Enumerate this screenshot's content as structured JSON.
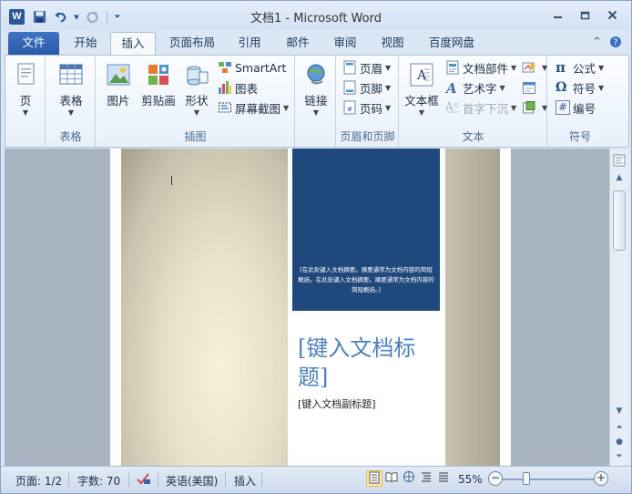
{
  "app": {
    "icon_letter": "W",
    "title": "文档1 - Microsoft Word"
  },
  "tabs": [
    {
      "label": "文件"
    },
    {
      "label": "开始"
    },
    {
      "label": "插入"
    },
    {
      "label": "页面布局"
    },
    {
      "label": "引用"
    },
    {
      "label": "邮件"
    },
    {
      "label": "审阅"
    },
    {
      "label": "视图"
    },
    {
      "label": "百度网盘"
    }
  ],
  "ribbon": {
    "groups": {
      "pages": {
        "label": "",
        "button": "页"
      },
      "table": {
        "label": "表格",
        "button": "表格"
      },
      "illustrations": {
        "label": "插图",
        "picture": "图片",
        "clipart": "剪贴画",
        "shapes": "形状",
        "smartart": "SmartArt",
        "chart": "图表",
        "screenshot": "屏幕截图"
      },
      "links": {
        "label": "",
        "button": "链接"
      },
      "header_footer": {
        "label": "页眉和页脚",
        "header": "页眉",
        "footer": "页脚",
        "page_number": "页码"
      },
      "text": {
        "label": "文本",
        "textbox": "文本框",
        "quick_parts": "文档部件",
        "wordart": "艺术字",
        "drop_cap": "首字下沉"
      },
      "symbols": {
        "label": "符号",
        "equation": "公式",
        "symbol": "符号",
        "number": "编号"
      }
    }
  },
  "document": {
    "abstract": "[在此处键入文档摘要。摘要通常为文档内容的简短概括。在此处键入文档摘要。摘要通常为文档内容的简短概括。]",
    "title": "[键入文档标题]",
    "subtitle": "[键入文档副标题]"
  },
  "status": {
    "page": "页面: 1/2",
    "words": "字数: 70",
    "language": "英语(美国)",
    "mode": "插入",
    "zoom": "55%",
    "zoom_value": 55
  },
  "colors": {
    "accent_blue": "#1f497d",
    "title_blue": "#4f81bd",
    "file_tab": "#2a5aa8"
  }
}
